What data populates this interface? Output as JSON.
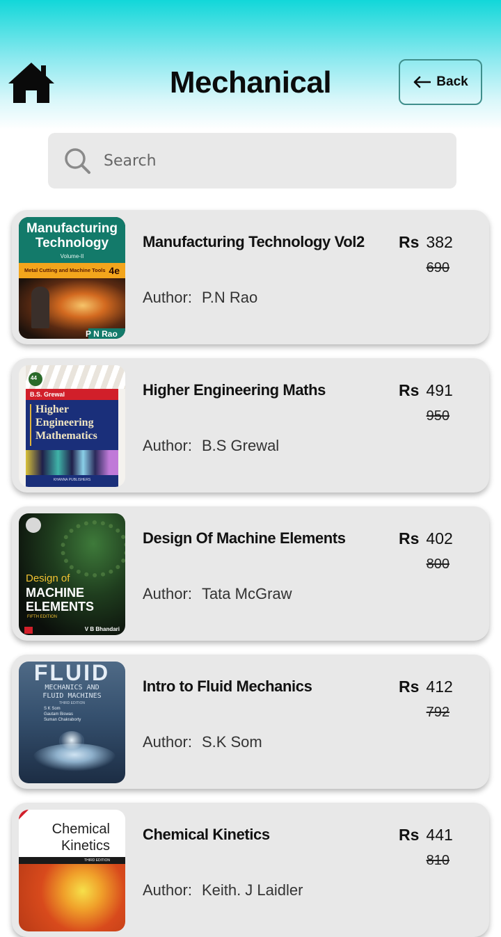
{
  "header": {
    "title": "Mechanical",
    "back_label": "Back"
  },
  "search": {
    "placeholder": "Search"
  },
  "currency_label": "Rs",
  "author_label": "Author:",
  "books": [
    {
      "title": "Manufacturing Technology Vol2",
      "price": "382",
      "mrp": "690",
      "author": "P.N Rao",
      "cover": {
        "line1": "Manufacturing",
        "line2": "Technology",
        "line3": "Volume-II",
        "band": "Metal Cutting and Machine Tools",
        "edition": "4e",
        "author": "P N Rao"
      }
    },
    {
      "title": "Higher Engineering Maths",
      "price": "491",
      "mrp": "950",
      "author": "B.S Grewal",
      "cover": {
        "badge": "44",
        "author": "B.S. Grewal",
        "line1": "Higher",
        "line2": "Engineering",
        "line3": "Mathematics",
        "publisher": "KHANNA PUBLISHERS"
      }
    },
    {
      "title": "Design Of Machine Elements",
      "price": "402",
      "mrp": "800",
      "author": "Tata McGraw",
      "cover": {
        "line1": "Design of",
        "line2": "MACHINE",
        "line3": "ELEMENTS",
        "edition": "FIFTH EDITION",
        "author": "V B Bhandari"
      }
    },
    {
      "title": "Intro to Fluid Mechanics",
      "price": "412",
      "mrp": "792",
      "author": "S.K Som",
      "cover": {
        "line1": "FLUID",
        "line2": "MECHANICS AND",
        "line3": "FLUID MACHINES",
        "edition": "THIRD EDITION",
        "authors": "S K Som\nGautam Biswas\nSuman Chakraborty"
      }
    },
    {
      "title": "Chemical Kinetics",
      "price": "441",
      "mrp": "810",
      "author": "Keith. J Laidler",
      "cover": {
        "line1": "Chemical",
        "line2": "Kinetics",
        "edition": "THIRD EDITION"
      }
    }
  ],
  "colors": {
    "header_top": "#12d7d9",
    "card_bg": "#e8e8e8",
    "back_border": "#3f8f8c"
  }
}
